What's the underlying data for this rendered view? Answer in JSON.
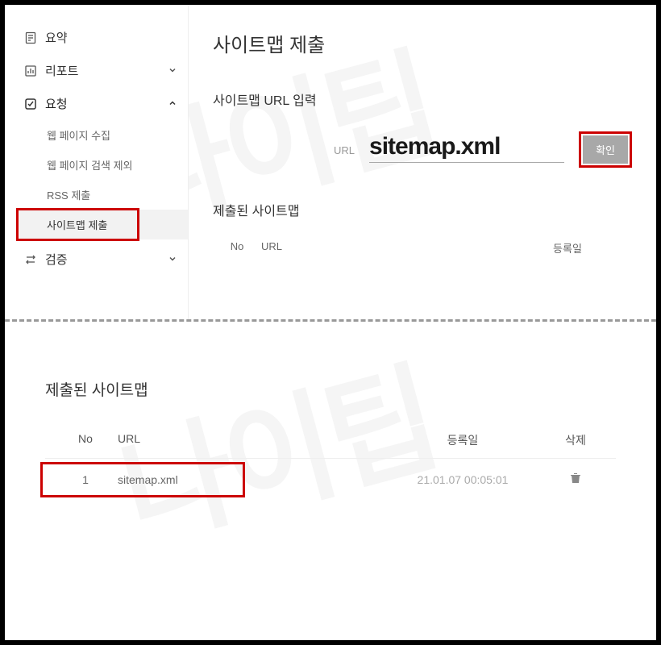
{
  "watermark_text": "나이팁",
  "sidebar": {
    "items": [
      {
        "label": "요약",
        "icon": "document"
      },
      {
        "label": "리포트",
        "icon": "bar-chart",
        "chevron": "down"
      },
      {
        "label": "요청",
        "icon": "check-square",
        "chevron": "up"
      },
      {
        "label": "검증",
        "icon": "swap",
        "chevron": "down"
      }
    ],
    "request_children": [
      {
        "label": "웹 페이지 수집"
      },
      {
        "label": "웹 페이지 검색 제외"
      },
      {
        "label": "RSS 제출"
      },
      {
        "label": "사이트맵 제출",
        "active": true
      }
    ]
  },
  "main": {
    "page_title": "사이트맵 제출",
    "input_section_label": "사이트맵 URL 입력",
    "url_label": "URL",
    "sitemap_value": "sitemap.xml",
    "confirm_label": "확인",
    "submitted_label": "제출된 사이트맵",
    "table_head": {
      "no": "No",
      "url": "URL",
      "date": "등록일"
    }
  },
  "bottom": {
    "title": "제출된 사이트맵",
    "table_head": {
      "no": "No",
      "url": "URL",
      "date": "등록일",
      "del": "삭제"
    },
    "rows": [
      {
        "no": "1",
        "url": "sitemap.xml",
        "date": "21.01.07 00:05:01"
      }
    ]
  }
}
